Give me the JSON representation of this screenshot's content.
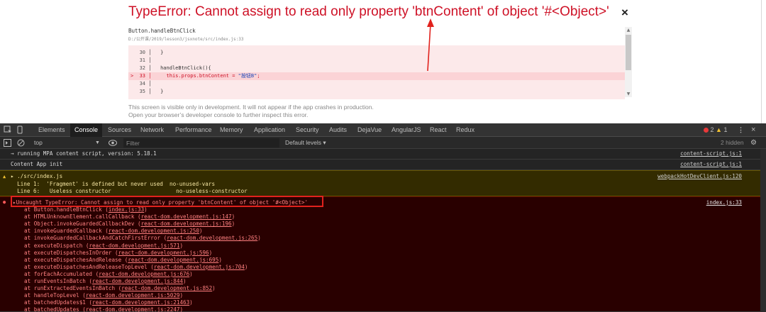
{
  "overlay": {
    "title": "TypeError: Cannot assign to read only property 'btnContent' of object '#<Object>'",
    "close_glyph": "×",
    "function_name": "Button.handleBtnClick",
    "file_path": "D:/公开课/2019/lesson3/jsxnote/src/index.js:33",
    "code_lines": [
      {
        "num": "30",
        "text": "  }",
        "highlight": false
      },
      {
        "num": "31",
        "text": "",
        "highlight": false
      },
      {
        "num": "32",
        "text": "  handleBtnClick(){",
        "highlight": false
      },
      {
        "num": "33",
        "text": "    this.props.btnContent = ",
        "string": "\"按钮B\"",
        "tail": ";",
        "highlight": true,
        "marker": ">"
      },
      {
        "num": "34",
        "text": "",
        "highlight": false
      },
      {
        "num": "35",
        "text": "  }",
        "highlight": false
      }
    ],
    "footer_line1": "This screen is visible only in development. It will not appear if the app crashes in production.",
    "footer_line2": "Open your browser’s developer console to further inspect this error.",
    "accent_color": "#ce1126"
  },
  "devtools": {
    "tabs": [
      "Elements",
      "Console",
      "Sources",
      "Network",
      "Performance",
      "Memory",
      "Application",
      "Security",
      "Audits",
      "DejaVue",
      "AngularJS",
      "React",
      "Redux"
    ],
    "active_tab": "Console",
    "error_count": "2",
    "warning_count": "1",
    "context": "top",
    "filter_placeholder": "Filter",
    "levels": "Default levels ▾",
    "hidden_count": "2 hidden",
    "messages": {
      "m1_text": "→ running MPA content script, version: 5.18.1",
      "m1_src": "content-script.js:1",
      "m2_text": "Content App init",
      "m2_src": "content-script.js:1",
      "warn_title": "▸ ./src/index.js",
      "warn_line1": "  Line 1:  'Fragment' is defined but never used  no-unused-vars",
      "warn_line2": "  Line 6:   Useless constructor                    no-useless-constructor",
      "warn_src": "webpackHotDevClient.js:120",
      "err_title": "▸Uncaught TypeError: Cannot assign to read only property 'btnContent' of object '#<Object>'",
      "err_src": "index.js:33",
      "stack": [
        {
          "pre": "at Button.handleBtnClick (",
          "link": "index.js:33",
          "post": ")"
        },
        {
          "pre": "at HTMLUnknownElement.callCallback (",
          "link": "react-dom.development.js:147",
          "post": ")"
        },
        {
          "pre": "at Object.invokeGuardedCallbackDev (",
          "link": "react-dom.development.js:196",
          "post": ")"
        },
        {
          "pre": "at invokeGuardedCallback (",
          "link": "react-dom.development.js:250",
          "post": ")"
        },
        {
          "pre": "at invokeGuardedCallbackAndCatchFirstError (",
          "link": "react-dom.development.js:265",
          "post": ")"
        },
        {
          "pre": "at executeDispatch (",
          "link": "react-dom.development.js:571",
          "post": ")"
        },
        {
          "pre": "at executeDispatchesInOrder (",
          "link": "react-dom.development.js:596",
          "post": ")"
        },
        {
          "pre": "at executeDispatchesAndRelease (",
          "link": "react-dom.development.js:695",
          "post": ")"
        },
        {
          "pre": "at executeDispatchesAndReleaseTopLevel (",
          "link": "react-dom.development.js:704",
          "post": ")"
        },
        {
          "pre": "at forEachAccumulated (",
          "link": "react-dom.development.js:676",
          "post": ")"
        },
        {
          "pre": "at runEventsInBatch (",
          "link": "react-dom.development.js:844",
          "post": ")"
        },
        {
          "pre": "at runExtractedEventsInBatch (",
          "link": "react-dom.development.js:852",
          "post": ")"
        },
        {
          "pre": "at handleTopLevel (",
          "link": "react-dom.development.js:5029",
          "post": ")"
        },
        {
          "pre": "at batchedUpdates$1 (",
          "link": "react-dom.development.js:21463",
          "post": ")"
        },
        {
          "pre": "at batchedUpdates (",
          "link": "react-dom.development.js:2247",
          "post": ")"
        }
      ]
    },
    "colors": {
      "error": "#ff8080",
      "warning_bg": "#332b00",
      "error_bg": "#290000",
      "highlight_box": "#e1221d"
    }
  }
}
